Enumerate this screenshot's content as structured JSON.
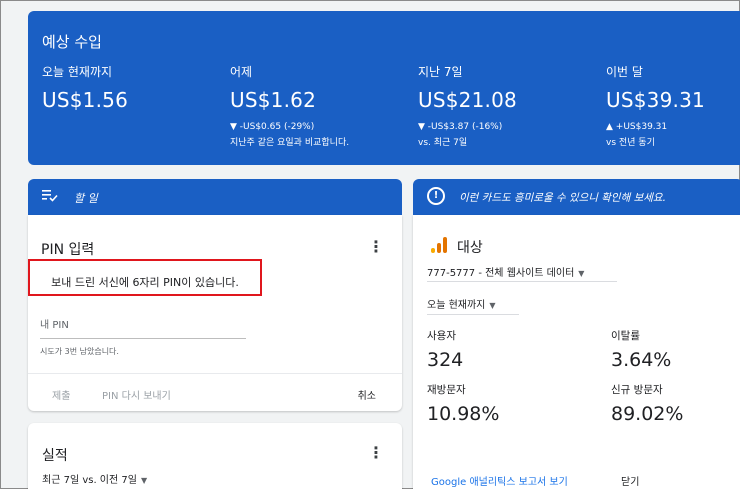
{
  "earnings": {
    "title": "예상 수입",
    "metrics": [
      {
        "label": "오늘 현재까지",
        "value": "US$1.56",
        "change": "",
        "compare": ""
      },
      {
        "label": "어제",
        "value": "US$1.62",
        "change": "▼ -US$0.65 (-29%)",
        "compare": "지난주 같은 요일과 비교합니다."
      },
      {
        "label": "지난 7일",
        "value": "US$21.08",
        "change": "▼ -US$3.87 (-16%)",
        "compare": "vs. 최근 7일"
      },
      {
        "label": "이번 달",
        "value": "US$39.31",
        "change": "▲ +US$39.31",
        "compare": "vs 전년 동기"
      }
    ]
  },
  "todo": {
    "header": "할 일",
    "pin": {
      "title": "PIN 입력",
      "message": "보내 드린 서신에 6자리 PIN이 있습니다.",
      "input_placeholder": "내 PIN",
      "hint": "시도가 3번 남았습니다.",
      "submit": "제출",
      "resend": "PIN 다시 보내기",
      "cancel": "취소"
    }
  },
  "performance": {
    "title": "실적",
    "range": "최근 7일 vs. 이전 7일"
  },
  "interest": {
    "header": "이런 카드도 흥미로울 수 있으니 확인해 보세요.",
    "audience": {
      "title": "대상",
      "property": "777-5777 - 전체 웹사이트 데이터",
      "date_range": "오늘 현재까지",
      "stats": [
        {
          "label": "사용자",
          "value": "324"
        },
        {
          "label": "이탈률",
          "value": "3.64%"
        },
        {
          "label": "재방문자",
          "value": "10.98%"
        },
        {
          "label": "신규 방문자",
          "value": "89.02%"
        }
      ],
      "link": "Google 애널리틱스 보고서 보기",
      "close": "닫기"
    }
  },
  "colors": {
    "accent": "#1a5fc4",
    "highlight": "#e0161d"
  }
}
